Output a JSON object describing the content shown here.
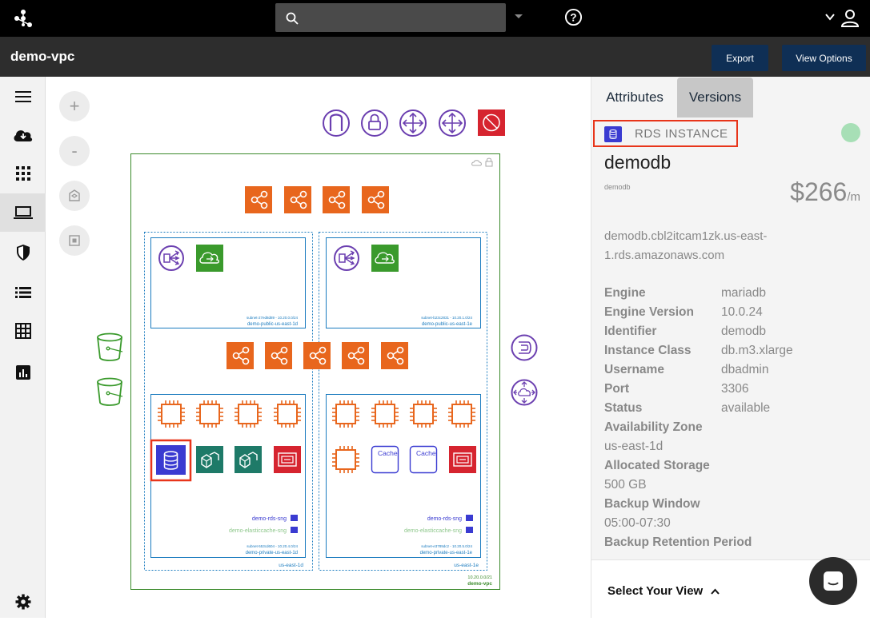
{
  "header": {
    "search_placeholder": "",
    "page_title": "demo-vpc",
    "export_label": "Export",
    "view_options_label": "View Options"
  },
  "sidebar": {
    "items": [
      {
        "name": "menu-icon"
      },
      {
        "name": "cloud-download-icon"
      },
      {
        "name": "apps-grid-icon"
      },
      {
        "name": "laptop-icon",
        "active": true
      },
      {
        "name": "shield-icon"
      },
      {
        "name": "list-icon"
      },
      {
        "name": "table-icon"
      },
      {
        "name": "chart-icon"
      },
      {
        "name": "gear-icon"
      }
    ]
  },
  "canvas": {
    "zoom_in": "+",
    "zoom_out": "-",
    "vpc_label": "demo-vpc",
    "vpc_cidr": "10.20.0.0/21",
    "az1_label": "us-east-1d",
    "az2_label": "us-east-1e",
    "subnets": {
      "pub1_id": "subnet-27ed8d89 - 10.20.0.0/24",
      "pub1_name": "demo-public-us-east-1d",
      "pub2_id": "subnet-b23c2831 - 10.20.1.0/24",
      "pub2_name": "demo-public-us-east-1e",
      "priv1_id": "subnet-553cd604 - 10.20.4.0/24",
      "priv1_name": "demo-private-us-east-1d",
      "priv2_id": "subnet-e3789dc2 - 10.20.5.0/24",
      "priv2_name": "demo-private-us-east-1e"
    },
    "sng1_rds": "demo-rds-sng",
    "sng1_cache": "demo-elasticcache-sng",
    "sng2_rds": "demo-rds-sng",
    "sng2_cache": "demo-elasticcache-sng",
    "cache_label": "Cache"
  },
  "panel": {
    "tabs": [
      "Attributes",
      "Versions"
    ],
    "resource_type": "RDS INSTANCE",
    "resource_name": "demodb",
    "resource_sub": "demodb",
    "price": "$266",
    "price_unit": "/m",
    "endpoint": "demodb.cbl2itcam1zk.us-east-1.rds.amazonaws.com",
    "attributes": [
      {
        "label": "Engine",
        "value": "mariadb"
      },
      {
        "label": "Engine Version",
        "value": "10.0.24"
      },
      {
        "label": "Identifier",
        "value": "demodb"
      },
      {
        "label": "Instance Class",
        "value": "db.m3.xlarge"
      },
      {
        "label": "Username",
        "value": "dbadmin"
      },
      {
        "label": "Port",
        "value": "3306"
      },
      {
        "label": "Status",
        "value": "available"
      }
    ],
    "stacked": [
      {
        "label": "Availability Zone",
        "value": "us-east-1d"
      },
      {
        "label": "Allocated Storage",
        "value": "500 GB"
      },
      {
        "label": "Backup Window",
        "value": "05:00-07:30"
      },
      {
        "label": "Backup Retention Period",
        "value": ""
      }
    ],
    "select_view": "Select Your View",
    "colors": {
      "accent": "#0f2f55",
      "highlight": "#e8351a",
      "status": "#a7dfb6"
    }
  }
}
